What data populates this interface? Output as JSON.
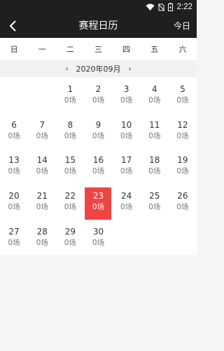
{
  "status_bar": {
    "time": "2:22"
  },
  "header": {
    "title": "赛程日历",
    "today_label": "今日"
  },
  "weekdays": [
    "日",
    "一",
    "二",
    "三",
    "四",
    "五",
    "六"
  ],
  "month_nav": {
    "label": "2020年09月",
    "prev": "‹",
    "next": "›"
  },
  "days": [
    {
      "day": "1",
      "matches": "0场"
    },
    {
      "day": "2",
      "matches": "0场"
    },
    {
      "day": "3",
      "matches": "0场"
    },
    {
      "day": "4",
      "matches": "0场"
    },
    {
      "day": "5",
      "matches": "0场"
    },
    {
      "day": "6",
      "matches": "0场"
    },
    {
      "day": "7",
      "matches": "0场"
    },
    {
      "day": "8",
      "matches": "0场"
    },
    {
      "day": "9",
      "matches": "0场"
    },
    {
      "day": "10",
      "matches": "0场"
    },
    {
      "day": "11",
      "matches": "0场"
    },
    {
      "day": "12",
      "matches": "0场"
    },
    {
      "day": "13",
      "matches": "0场"
    },
    {
      "day": "14",
      "matches": "0场"
    },
    {
      "day": "15",
      "matches": "0场"
    },
    {
      "day": "16",
      "matches": "0场"
    },
    {
      "day": "17",
      "matches": "0场"
    },
    {
      "day": "18",
      "matches": "0场"
    },
    {
      "day": "19",
      "matches": "0场"
    },
    {
      "day": "20",
      "matches": "0场"
    },
    {
      "day": "21",
      "matches": "0场"
    },
    {
      "day": "22",
      "matches": "0场"
    },
    {
      "day": "23",
      "matches": "0场"
    },
    {
      "day": "24",
      "matches": "0场"
    },
    {
      "day": "25",
      "matches": "0场"
    },
    {
      "day": "26",
      "matches": "0场"
    },
    {
      "day": "27",
      "matches": "0场"
    },
    {
      "day": "28",
      "matches": "0场"
    },
    {
      "day": "29",
      "matches": "0场"
    },
    {
      "day": "30",
      "matches": "0场"
    }
  ],
  "selected_day": "23",
  "first_weekday_index": 2,
  "colors": {
    "bar_bg": "#1f1f1f",
    "selected": "#ef4444"
  }
}
